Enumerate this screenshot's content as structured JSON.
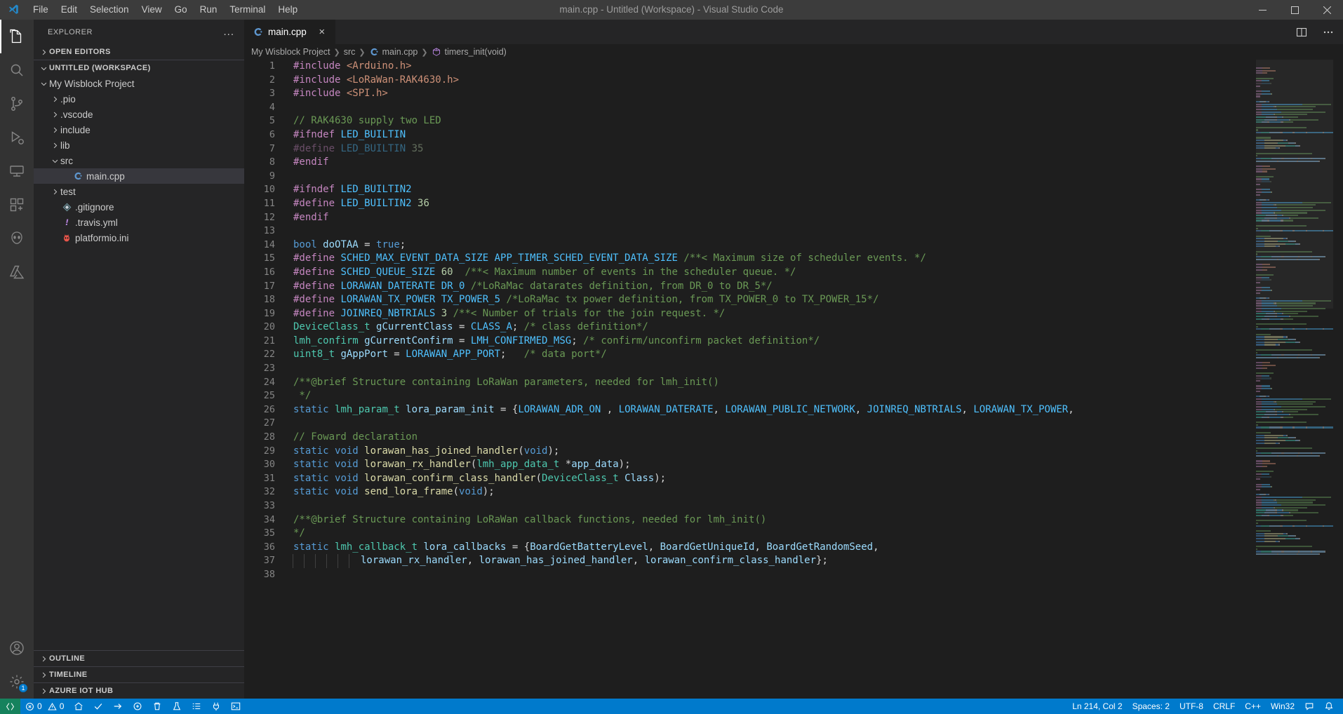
{
  "titlebar": {
    "title": "main.cpp - Untitled (Workspace) - Visual Studio Code",
    "logo_name": "vscode-logo",
    "menus": [
      "File",
      "Edit",
      "Selection",
      "View",
      "Go",
      "Run",
      "Terminal",
      "Help"
    ],
    "window_controls": [
      "minimize",
      "maximize",
      "close"
    ]
  },
  "activitybar": {
    "items": [
      {
        "name": "explorer",
        "icon": "files-icon",
        "active": true
      },
      {
        "name": "search",
        "icon": "search-icon",
        "active": false
      },
      {
        "name": "source-control",
        "icon": "source-control-icon",
        "active": false
      },
      {
        "name": "run-and-debug",
        "icon": "debug-icon",
        "active": false
      },
      {
        "name": "remote-explorer",
        "icon": "remote-icon",
        "active": false
      },
      {
        "name": "extensions",
        "icon": "extensions-icon",
        "active": false
      },
      {
        "name": "platformio",
        "icon": "platformio-alien-icon",
        "active": false
      },
      {
        "name": "azure",
        "icon": "azure-icon",
        "active": false
      }
    ],
    "bottom": [
      {
        "name": "accounts",
        "icon": "account-icon",
        "badge": ""
      },
      {
        "name": "manage",
        "icon": "gear-icon",
        "badge": "1"
      }
    ]
  },
  "sidebar": {
    "header": "EXPLORER",
    "more_actions": "...",
    "sections": [
      {
        "label": "OPEN EDITORS",
        "expanded": false
      },
      {
        "label": "UNTITLED (WORKSPACE)",
        "expanded": true
      }
    ],
    "tree": [
      {
        "label": "My Wisblock Project",
        "depth": 1,
        "type": "folder",
        "expanded": true,
        "icon": "chevron-down-icon"
      },
      {
        "label": ".pio",
        "depth": 2,
        "type": "folder",
        "expanded": false,
        "icon": "chevron-right-icon"
      },
      {
        "label": ".vscode",
        "depth": 2,
        "type": "folder",
        "expanded": false,
        "icon": "chevron-right-icon"
      },
      {
        "label": "include",
        "depth": 2,
        "type": "folder",
        "expanded": false,
        "icon": "chevron-right-icon"
      },
      {
        "label": "lib",
        "depth": 2,
        "type": "folder",
        "expanded": false,
        "icon": "chevron-right-icon"
      },
      {
        "label": "src",
        "depth": 2,
        "type": "folder",
        "expanded": true,
        "icon": "chevron-down-icon"
      },
      {
        "label": "main.cpp",
        "depth": 3,
        "type": "file",
        "selected": true,
        "icon": "cpp-file-icon"
      },
      {
        "label": "test",
        "depth": 2,
        "type": "folder",
        "expanded": false,
        "icon": "chevron-right-icon"
      },
      {
        "label": ".gitignore",
        "depth": 2,
        "type": "file",
        "icon": "git-file-icon"
      },
      {
        "label": ".travis.yml",
        "depth": 2,
        "type": "file",
        "icon": "travis-file-icon"
      },
      {
        "label": "platformio.ini",
        "depth": 2,
        "type": "file",
        "icon": "platformio-file-icon"
      }
    ],
    "bottom_sections": [
      {
        "label": "OUTLINE",
        "expanded": false
      },
      {
        "label": "TIMELINE",
        "expanded": false
      },
      {
        "label": "AZURE IOT HUB",
        "expanded": false
      }
    ]
  },
  "editor": {
    "tabs": [
      {
        "label": "main.cpp",
        "icon": "cpp-file-icon",
        "active": true,
        "close": "×"
      }
    ],
    "tab_actions": [
      {
        "name": "split-editor",
        "icon": "split-editor-icon"
      },
      {
        "name": "more-actions",
        "icon": "ellipsis-icon"
      }
    ],
    "breadcrumb": [
      {
        "label": "My Wisblock Project",
        "icon": ""
      },
      {
        "label": "src",
        "icon": ""
      },
      {
        "label": "main.cpp",
        "icon": "cpp-file-icon"
      },
      {
        "label": "timers_init(void)",
        "icon": "symbol-method-icon"
      }
    ],
    "first_line": 1,
    "lines": [
      {
        "n": 1,
        "tokens": [
          {
            "t": "#include ",
            "c": "t-pre"
          },
          {
            "t": "<Arduino.h>",
            "c": "t-str"
          }
        ]
      },
      {
        "n": 2,
        "tokens": [
          {
            "t": "#include ",
            "c": "t-pre"
          },
          {
            "t": "<LoRaWan-RAK4630.h>",
            "c": "t-str"
          }
        ]
      },
      {
        "n": 3,
        "tokens": [
          {
            "t": "#include ",
            "c": "t-pre"
          },
          {
            "t": "<SPI.h>",
            "c": "t-str"
          }
        ]
      },
      {
        "n": 4,
        "tokens": []
      },
      {
        "n": 5,
        "tokens": [
          {
            "t": "// RAK4630 supply two LED",
            "c": "t-com"
          }
        ]
      },
      {
        "n": 6,
        "tokens": [
          {
            "t": "#ifndef ",
            "c": "t-pre"
          },
          {
            "t": "LED_BUILTIN",
            "c": "t-macro"
          }
        ]
      },
      {
        "n": 7,
        "dim": true,
        "tokens": [
          {
            "t": "#define ",
            "c": "t-pre"
          },
          {
            "t": "LED_BUILTIN ",
            "c": "t-macro"
          },
          {
            "t": "35",
            "c": "t-num"
          }
        ]
      },
      {
        "n": 8,
        "tokens": [
          {
            "t": "#endif",
            "c": "t-pre"
          }
        ]
      },
      {
        "n": 9,
        "tokens": []
      },
      {
        "n": 10,
        "tokens": [
          {
            "t": "#ifndef ",
            "c": "t-pre"
          },
          {
            "t": "LED_BUILTIN2",
            "c": "t-macro"
          }
        ]
      },
      {
        "n": 11,
        "tokens": [
          {
            "t": "#define ",
            "c": "t-pre"
          },
          {
            "t": "LED_BUILTIN2 ",
            "c": "t-macro"
          },
          {
            "t": "36",
            "c": "t-num"
          }
        ]
      },
      {
        "n": 12,
        "tokens": [
          {
            "t": "#endif",
            "c": "t-pre"
          }
        ]
      },
      {
        "n": 13,
        "tokens": []
      },
      {
        "n": 14,
        "tokens": [
          {
            "t": "bool ",
            "c": "t-key"
          },
          {
            "t": "doOTAA",
            "c": "t-var"
          },
          {
            "t": " = ",
            "c": "t-plain"
          },
          {
            "t": "true",
            "c": "t-key"
          },
          {
            "t": ";",
            "c": "t-plain"
          }
        ]
      },
      {
        "n": 15,
        "tokens": [
          {
            "t": "#define ",
            "c": "t-pre"
          },
          {
            "t": "SCHED_MAX_EVENT_DATA_SIZE APP_TIMER_SCHED_EVENT_DATA_SIZE ",
            "c": "t-macro"
          },
          {
            "t": "/**< Maximum size of scheduler events. */",
            "c": "t-com"
          }
        ]
      },
      {
        "n": 16,
        "tokens": [
          {
            "t": "#define ",
            "c": "t-pre"
          },
          {
            "t": "SCHED_QUEUE_SIZE ",
            "c": "t-macro"
          },
          {
            "t": "60",
            "c": "t-num"
          },
          {
            "t": "  ",
            "c": "t-plain"
          },
          {
            "t": "/**< Maximum number of events in the scheduler queue. */",
            "c": "t-com"
          }
        ]
      },
      {
        "n": 17,
        "tokens": [
          {
            "t": "#define ",
            "c": "t-pre"
          },
          {
            "t": "LORAWAN_DATERATE DR_0 ",
            "c": "t-macro"
          },
          {
            "t": "/*LoRaMac datarates definition, from DR_0 to DR_5*/",
            "c": "t-com"
          }
        ]
      },
      {
        "n": 18,
        "tokens": [
          {
            "t": "#define ",
            "c": "t-pre"
          },
          {
            "t": "LORAWAN_TX_POWER TX_POWER_5 ",
            "c": "t-macro"
          },
          {
            "t": "/*LoRaMac tx power definition, from TX_POWER_0 to TX_POWER_15*/",
            "c": "t-com"
          }
        ]
      },
      {
        "n": 19,
        "tokens": [
          {
            "t": "#define ",
            "c": "t-pre"
          },
          {
            "t": "JOINREQ_NBTRIALS ",
            "c": "t-macro"
          },
          {
            "t": "3",
            "c": "t-num"
          },
          {
            "t": " ",
            "c": "t-plain"
          },
          {
            "t": "/**< Number of trials for the join request. */",
            "c": "t-com"
          }
        ]
      },
      {
        "n": 20,
        "tokens": [
          {
            "t": "DeviceClass_t ",
            "c": "t-type"
          },
          {
            "t": "gCurrentClass",
            "c": "t-var"
          },
          {
            "t": " = ",
            "c": "t-plain"
          },
          {
            "t": "CLASS_A",
            "c": "t-macro"
          },
          {
            "t": "; ",
            "c": "t-plain"
          },
          {
            "t": "/* class definition*/",
            "c": "t-com"
          }
        ]
      },
      {
        "n": 21,
        "tokens": [
          {
            "t": "lmh_confirm ",
            "c": "t-type"
          },
          {
            "t": "gCurrentConfirm",
            "c": "t-var"
          },
          {
            "t": " = ",
            "c": "t-plain"
          },
          {
            "t": "LMH_CONFIRMED_MSG",
            "c": "t-macro"
          },
          {
            "t": "; ",
            "c": "t-plain"
          },
          {
            "t": "/* confirm/unconfirm packet definition*/",
            "c": "t-com"
          }
        ]
      },
      {
        "n": 22,
        "tokens": [
          {
            "t": "uint8_t ",
            "c": "t-type"
          },
          {
            "t": "gAppPort",
            "c": "t-var"
          },
          {
            "t": " = ",
            "c": "t-plain"
          },
          {
            "t": "LORAWAN_APP_PORT",
            "c": "t-macro"
          },
          {
            "t": ";   ",
            "c": "t-plain"
          },
          {
            "t": "/* data port*/",
            "c": "t-com"
          }
        ]
      },
      {
        "n": 23,
        "tokens": []
      },
      {
        "n": 24,
        "tokens": [
          {
            "t": "/**@brief Structure containing LoRaWan parameters, needed for lmh_init()",
            "c": "t-com"
          }
        ]
      },
      {
        "n": 25,
        "tokens": [
          {
            "t": " */",
            "c": "t-com"
          }
        ]
      },
      {
        "n": 26,
        "tokens": [
          {
            "t": "static ",
            "c": "t-key"
          },
          {
            "t": "lmh_param_t ",
            "c": "t-type"
          },
          {
            "t": "lora_param_init",
            "c": "t-var"
          },
          {
            "t": " = {",
            "c": "t-plain"
          },
          {
            "t": "LORAWAN_ADR_ON",
            "c": "t-macro"
          },
          {
            "t": " , ",
            "c": "t-plain"
          },
          {
            "t": "LORAWAN_DATERATE",
            "c": "t-macro"
          },
          {
            "t": ", ",
            "c": "t-plain"
          },
          {
            "t": "LORAWAN_PUBLIC_NETWORK",
            "c": "t-macro"
          },
          {
            "t": ", ",
            "c": "t-plain"
          },
          {
            "t": "JOINREQ_NBTRIALS",
            "c": "t-macro"
          },
          {
            "t": ", ",
            "c": "t-plain"
          },
          {
            "t": "LORAWAN_TX_POWER",
            "c": "t-macro"
          },
          {
            "t": ",",
            "c": "t-plain"
          }
        ]
      },
      {
        "n": 27,
        "tokens": []
      },
      {
        "n": 28,
        "tokens": [
          {
            "t": "// Foward declaration",
            "c": "t-com"
          }
        ]
      },
      {
        "n": 29,
        "tokens": [
          {
            "t": "static ",
            "c": "t-key"
          },
          {
            "t": "void ",
            "c": "t-key"
          },
          {
            "t": "lorawan_has_joined_handler",
            "c": "t-fn"
          },
          {
            "t": "(",
            "c": "t-plain"
          },
          {
            "t": "void",
            "c": "t-key"
          },
          {
            "t": ");",
            "c": "t-plain"
          }
        ]
      },
      {
        "n": 30,
        "tokens": [
          {
            "t": "static ",
            "c": "t-key"
          },
          {
            "t": "void ",
            "c": "t-key"
          },
          {
            "t": "lorawan_rx_handler",
            "c": "t-fn"
          },
          {
            "t": "(",
            "c": "t-plain"
          },
          {
            "t": "lmh_app_data_t ",
            "c": "t-type"
          },
          {
            "t": "*",
            "c": "t-plain"
          },
          {
            "t": "app_data",
            "c": "t-var"
          },
          {
            "t": ");",
            "c": "t-plain"
          }
        ]
      },
      {
        "n": 31,
        "tokens": [
          {
            "t": "static ",
            "c": "t-key"
          },
          {
            "t": "void ",
            "c": "t-key"
          },
          {
            "t": "lorawan_confirm_class_handler",
            "c": "t-fn"
          },
          {
            "t": "(",
            "c": "t-plain"
          },
          {
            "t": "DeviceClass_t ",
            "c": "t-type"
          },
          {
            "t": "Class",
            "c": "t-var"
          },
          {
            "t": ");",
            "c": "t-plain"
          }
        ]
      },
      {
        "n": 32,
        "tokens": [
          {
            "t": "static ",
            "c": "t-key"
          },
          {
            "t": "void ",
            "c": "t-key"
          },
          {
            "t": "send_lora_frame",
            "c": "t-fn"
          },
          {
            "t": "(",
            "c": "t-plain"
          },
          {
            "t": "void",
            "c": "t-key"
          },
          {
            "t": ");",
            "c": "t-plain"
          }
        ]
      },
      {
        "n": 33,
        "tokens": []
      },
      {
        "n": 34,
        "tokens": [
          {
            "t": "/**@brief Structure containing LoRaWan callback functions, needed for lmh_init()",
            "c": "t-com"
          }
        ]
      },
      {
        "n": 35,
        "tokens": [
          {
            "t": "*/",
            "c": "t-com"
          }
        ]
      },
      {
        "n": 36,
        "tokens": [
          {
            "t": "static ",
            "c": "t-key"
          },
          {
            "t": "lmh_callback_t ",
            "c": "t-type"
          },
          {
            "t": "lora_callbacks",
            "c": "t-var"
          },
          {
            "t": " = {",
            "c": "t-plain"
          },
          {
            "t": "BoardGetBatteryLevel",
            "c": "t-var"
          },
          {
            "t": ", ",
            "c": "t-plain"
          },
          {
            "t": "BoardGetUniqueId",
            "c": "t-var"
          },
          {
            "t": ", ",
            "c": "t-plain"
          },
          {
            "t": "BoardGetRandomSeed",
            "c": "t-var"
          },
          {
            "t": ",",
            "c": "t-plain"
          }
        ]
      },
      {
        "n": 37,
        "indent_guides": 6,
        "tokens": [
          {
            "t": "            lorawan_rx_handler",
            "c": "t-var"
          },
          {
            "t": ", ",
            "c": "t-plain"
          },
          {
            "t": "lorawan_has_joined_handler",
            "c": "t-var"
          },
          {
            "t": ", ",
            "c": "t-plain"
          },
          {
            "t": "lorawan_confirm_class_handler",
            "c": "t-var"
          },
          {
            "t": "};",
            "c": "t-plain"
          }
        ]
      },
      {
        "n": 38,
        "tokens": []
      }
    ]
  },
  "statusbar": {
    "left": [
      {
        "name": "remote-indicator",
        "text": "",
        "icon": "remote-icon"
      },
      {
        "name": "problems",
        "text": "0",
        "icon": "error-icon",
        "text2": "0",
        "icon2": "warning-icon"
      },
      {
        "name": "pio-home",
        "text": "",
        "icon": "home-icon"
      },
      {
        "name": "pio-build",
        "text": "",
        "icon": "check-icon"
      },
      {
        "name": "pio-upload",
        "text": "",
        "icon": "arrow-right-icon"
      },
      {
        "name": "pio-upload-monitor",
        "text": "",
        "icon": "plug-icon"
      },
      {
        "name": "pio-clean",
        "text": "",
        "icon": "trash-icon"
      },
      {
        "name": "pio-test",
        "text": "",
        "icon": "beaker-icon"
      },
      {
        "name": "pio-tasks",
        "text": "",
        "icon": "list-icon"
      },
      {
        "name": "pio-serial-monitor",
        "text": "",
        "icon": "plug2-icon"
      },
      {
        "name": "pio-terminal",
        "text": "",
        "icon": "terminal-icon"
      }
    ],
    "right": [
      {
        "name": "editor-position",
        "text": "Ln 214, Col 2"
      },
      {
        "name": "editor-indentation",
        "text": "Spaces: 2"
      },
      {
        "name": "editor-encoding",
        "text": "UTF-8"
      },
      {
        "name": "editor-eol",
        "text": "CRLF"
      },
      {
        "name": "editor-language",
        "text": "C++"
      },
      {
        "name": "editor-platform",
        "text": "Win32"
      },
      {
        "name": "feedback",
        "text": "",
        "icon": "feedback-icon"
      },
      {
        "name": "notifications",
        "text": "",
        "icon": "bell-icon"
      }
    ],
    "problems_errors": "0",
    "problems_warnings": "0"
  },
  "colors": {
    "accent": "#007acc",
    "titlebar_bg": "#3c3c3c",
    "sidebar_bg": "#252526",
    "editor_bg": "#1e1e1e",
    "activitybar_bg": "#333333"
  }
}
